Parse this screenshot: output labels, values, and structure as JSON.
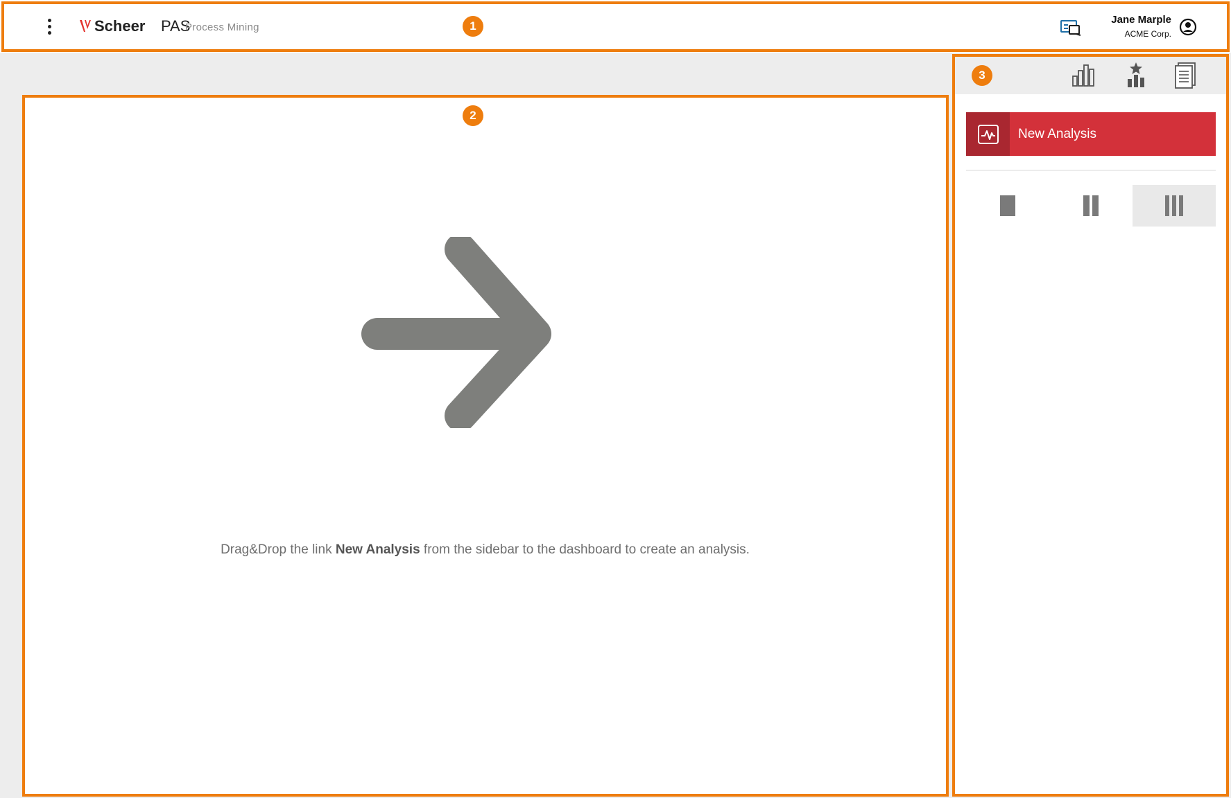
{
  "header": {
    "brand_bold": "Scheer",
    "brand_light": "PAS",
    "app_name": "Process Mining",
    "user_name": "Jane Marple",
    "user_org": "ACME Corp."
  },
  "dashboard": {
    "hint_before": "Drag&Drop the link ",
    "hint_bold": "New Analysis",
    "hint_after": " from the sidebar to the dashboard to create an analysis."
  },
  "sidebar": {
    "toolbar_icons": [
      "bar-chart-icon",
      "favorites-chart-icon",
      "documents-icon"
    ],
    "new_analysis_label": "New Analysis",
    "layouts": [
      "one-column",
      "two-columns",
      "three-columns"
    ],
    "selected_layout": "three-columns"
  },
  "annotations": [
    "1",
    "2",
    "3"
  ],
  "colors": {
    "accent": "#d3313a",
    "accent_dark": "#a92730",
    "annotation": "#ee7d0e",
    "screen_icon": "#1e6fa8"
  }
}
